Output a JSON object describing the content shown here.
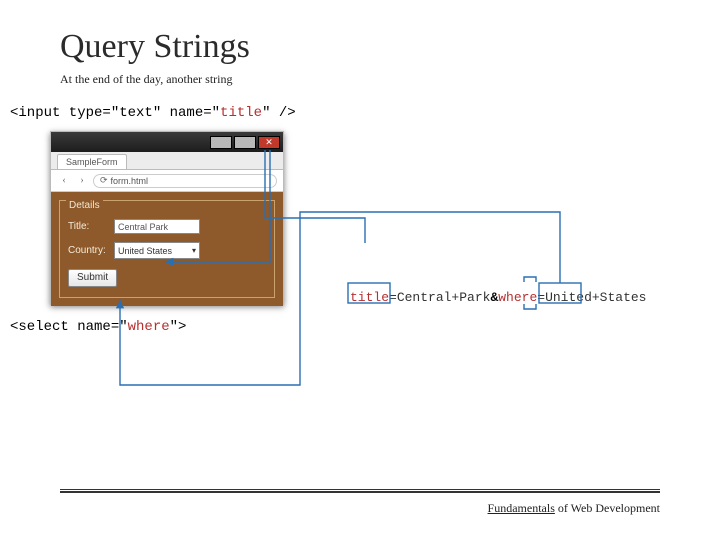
{
  "title": "Query Strings",
  "subtitle": "At the end of the day, another string",
  "code_top": {
    "pre": "<input type=\"text\" name=\"",
    "highlight": "title",
    "post": "\" />"
  },
  "code_bottom": {
    "pre": "<select name=\"",
    "highlight": "where",
    "post": "\">"
  },
  "browser": {
    "tab_label": "SampleForm",
    "url_text": "form.html",
    "close_glyph": "✕",
    "back_glyph": "‹",
    "fwd_glyph": "›",
    "reload_glyph": "⟳"
  },
  "form": {
    "legend": "Details",
    "title_label": "Title:",
    "title_value": "Central Park",
    "country_label": "Country:",
    "country_value": "United States",
    "caret": "▾",
    "submit_label": "Submit"
  },
  "query_string": {
    "key1": "title",
    "val1": "=Central+Park",
    "amp": "&",
    "key2": "where",
    "val2": "=United+States"
  },
  "footer": {
    "underlined": "Fundamentals",
    "rest": " of Web Development"
  }
}
